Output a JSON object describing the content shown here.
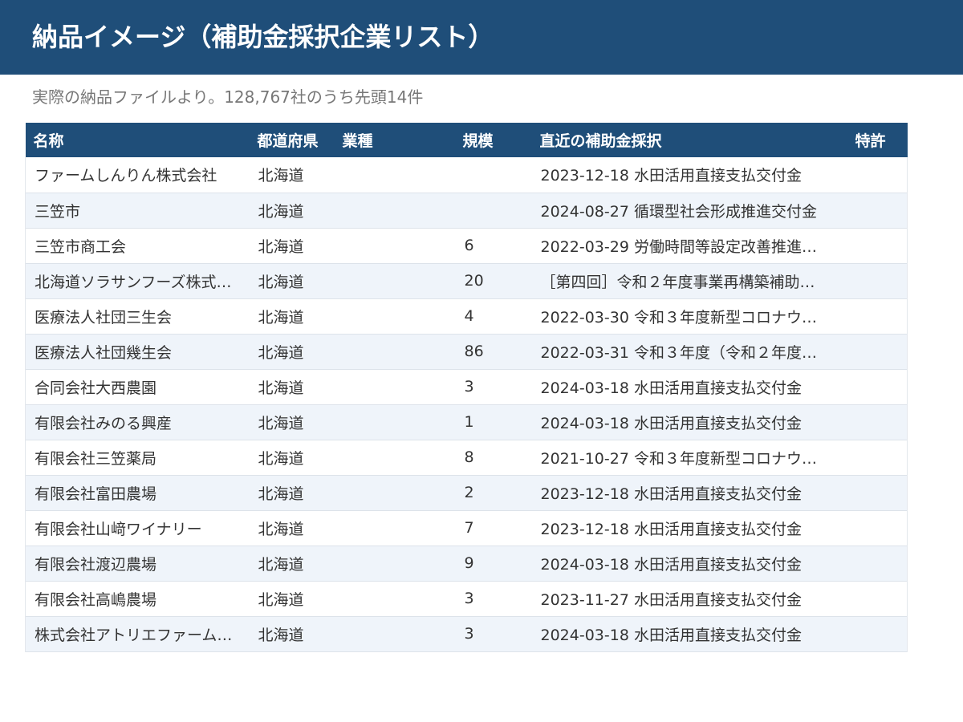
{
  "header": {
    "title": "納品イメージ（補助金採択企業リスト）"
  },
  "subtitle": "実際の納品ファイルより。128,767社のうち先頭14件",
  "colors": {
    "header_bg": "#1f4e79",
    "row_alt_bg": "#eff4fa",
    "subtitle_text": "#777777"
  },
  "table": {
    "columns": [
      "名称",
      "都道府県",
      "業種",
      "規模",
      "直近の補助金採択",
      "特許"
    ],
    "rows": [
      {
        "name": "ファームしんりん株式会社",
        "pref": "北海道",
        "industry": "",
        "scale": "",
        "grant": "2023-12-18 水田活用直接支払交付金",
        "patent": ""
      },
      {
        "name": "三笠市",
        "pref": "北海道",
        "industry": "",
        "scale": "",
        "grant": "2024-08-27 循環型社会形成推進交付金",
        "patent": ""
      },
      {
        "name": "三笠市商工会",
        "pref": "北海道",
        "industry": "",
        "scale": "6",
        "grant": "2022-03-29 労働時間等設定改善推進…",
        "patent": ""
      },
      {
        "name": "北海道ソラサンフーズ株式…",
        "pref": "北海道",
        "industry": "",
        "scale": "20",
        "grant": "［第四回］令和２年度事業再構築補助…",
        "patent": ""
      },
      {
        "name": "医療法人社団三生会",
        "pref": "北海道",
        "industry": "",
        "scale": "4",
        "grant": "2022-03-30 令和３年度新型コロナウ…",
        "patent": ""
      },
      {
        "name": "医療法人社団幾生会",
        "pref": "北海道",
        "industry": "",
        "scale": "86",
        "grant": "2022-03-31 令和３年度（令和２年度…",
        "patent": ""
      },
      {
        "name": "合同会社大西農園",
        "pref": "北海道",
        "industry": "",
        "scale": "3",
        "grant": "2024-03-18 水田活用直接支払交付金",
        "patent": ""
      },
      {
        "name": "有限会社みのる興産",
        "pref": "北海道",
        "industry": "",
        "scale": "1",
        "grant": "2024-03-18 水田活用直接支払交付金",
        "patent": ""
      },
      {
        "name": "有限会社三笠薬局",
        "pref": "北海道",
        "industry": "",
        "scale": "8",
        "grant": "2021-10-27 令和３年度新型コロナウ…",
        "patent": ""
      },
      {
        "name": "有限会社富田農場",
        "pref": "北海道",
        "industry": "",
        "scale": "2",
        "grant": "2023-12-18 水田活用直接支払交付金",
        "patent": ""
      },
      {
        "name": "有限会社山﨑ワイナリー",
        "pref": "北海道",
        "industry": "",
        "scale": "7",
        "grant": "2023-12-18 水田活用直接支払交付金",
        "patent": ""
      },
      {
        "name": "有限会社渡辺農場",
        "pref": "北海道",
        "industry": "",
        "scale": "9",
        "grant": "2024-03-18 水田活用直接支払交付金",
        "patent": ""
      },
      {
        "name": "有限会社高嶋農場",
        "pref": "北海道",
        "industry": "",
        "scale": "3",
        "grant": "2023-11-27 水田活用直接支払交付金",
        "patent": ""
      },
      {
        "name": "株式会社アトリエファーム…",
        "pref": "北海道",
        "industry": "",
        "scale": "3",
        "grant": "2024-03-18 水田活用直接支払交付金",
        "patent": ""
      }
    ]
  }
}
